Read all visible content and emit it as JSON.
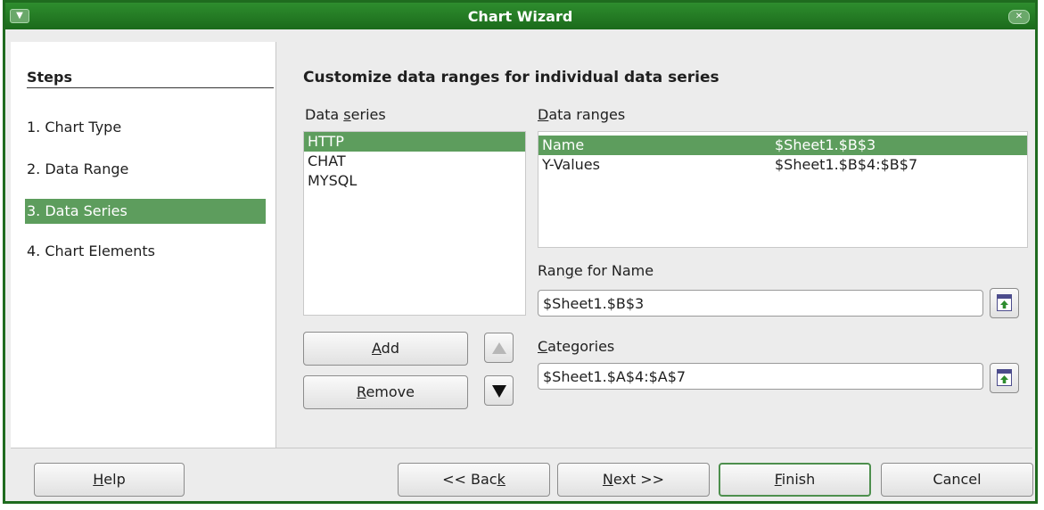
{
  "window": {
    "title": "Chart Wizard",
    "menu_icon": "window-menu-icon",
    "close_icon": "window-close-icon"
  },
  "steps": {
    "heading": "Steps",
    "items": [
      {
        "label": "1. Chart Type",
        "active": false
      },
      {
        "label": "2. Data Range",
        "active": false
      },
      {
        "label": "3. Data Series",
        "active": true
      },
      {
        "label": "4. Chart Elements",
        "active": false
      }
    ]
  },
  "main": {
    "title": "Customize data ranges for individual data series",
    "data_series": {
      "label_pre": "Data ",
      "label_u": "s",
      "label_post": "eries",
      "items": [
        "HTTP",
        "CHAT",
        "MYSQL"
      ],
      "selected_index": 0
    },
    "data_ranges": {
      "label_u": "D",
      "label_post": "ata ranges",
      "rows": [
        {
          "name": "Name",
          "range": "$Sheet1.$B$3"
        },
        {
          "name": "Y-Values",
          "range": "$Sheet1.$B$4:$B$7"
        }
      ],
      "selected_index": 0
    },
    "range_for_name": {
      "label_pre": "Ran",
      "label_u": "g",
      "label_post": "e for Name",
      "value": "$Sheet1.$B$3"
    },
    "categories": {
      "label_u": "C",
      "label_post": "ategories",
      "value": "$Sheet1.$A$4:$A$7"
    },
    "buttons": {
      "add_u": "A",
      "add_post": "dd",
      "remove_u": "R",
      "remove_post": "emove",
      "move_up_icon": "triangle-up-icon",
      "move_down_icon": "triangle-down-icon"
    }
  },
  "footer": {
    "help_u": "H",
    "help_post": "elp",
    "back_pre": "<< Bac",
    "back_u": "k",
    "next_u": "N",
    "next_post": "ext >>",
    "finish_u": "F",
    "finish_post": "inish",
    "cancel": "Cancel"
  },
  "colors": {
    "accent": "#5d9d5d",
    "titlebar": "#2e8d2e",
    "border": "#1f6b1f"
  }
}
